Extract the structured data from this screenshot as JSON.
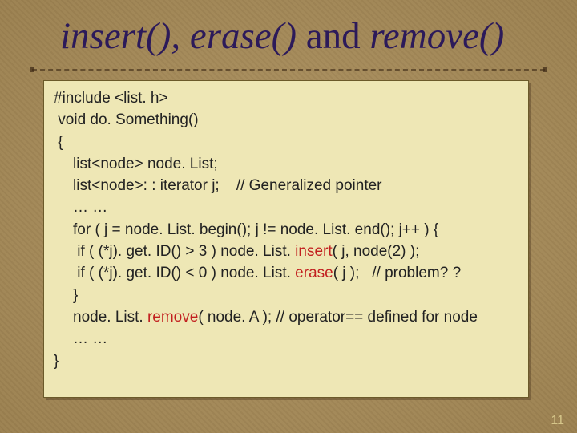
{
  "title": {
    "a": "insert()",
    "comma": ", ",
    "b": "erase()",
    "and": " and ",
    "c": "remove()"
  },
  "code": {
    "l1": "#include <list. h>",
    "l2": " void do. Something()",
    "l3": " {",
    "l4": "list<node> node. List;",
    "l5a": "list<node>: : iterator j;",
    "l5b": "    // Generalized pointer",
    "l6": "… …",
    "l7": "for ( j = node. List. begin(); j != node. List. end(); j++ ) {",
    "l8a": " if ( (*j). get. ID() > 3 ) node. List. ",
    "l8_ins": "insert",
    "l8b": "( j, node(2) );",
    "l9a": " if ( (*j). get. ID() < 0 ) node. List. ",
    "l9_erase": "erase",
    "l9b": "( j );   // problem? ?",
    "l10": "}",
    "l11a": "node. List. ",
    "l11_remove": "remove",
    "l11b": "( node. A ); // operator== defined for node",
    "l12": "… …",
    "l13": "}"
  },
  "pagenum": "11"
}
